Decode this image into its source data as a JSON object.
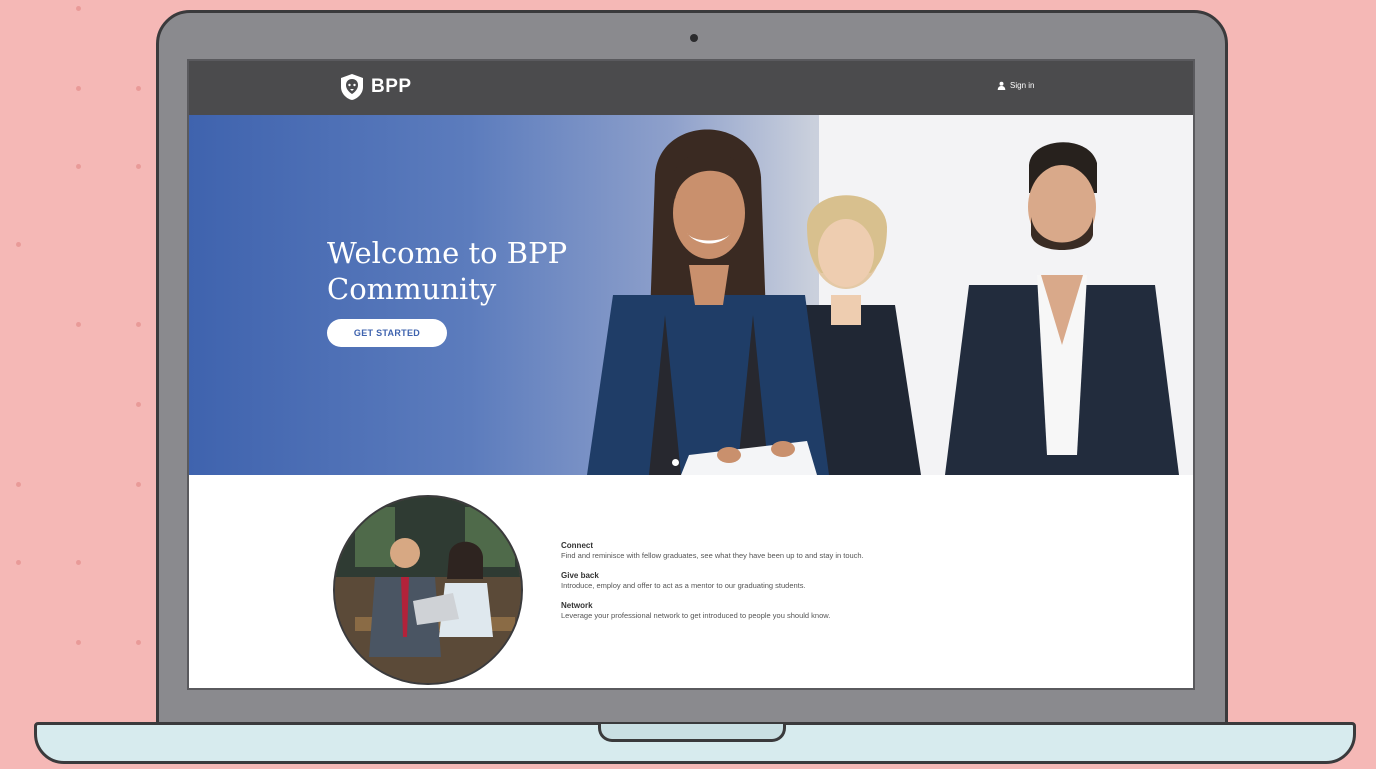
{
  "header": {
    "brand": "BPP",
    "signin_label": "Sign in"
  },
  "hero": {
    "title_line1": "Welcome to BPP",
    "title_line2": "Community",
    "cta_label": "GET STARTED"
  },
  "features": [
    {
      "title": "Connect",
      "text": "Find and reminisce with fellow graduates, see what they have been up to and stay in touch."
    },
    {
      "title": "Give back",
      "text": "Introduce, employ and offer to act as a mentor to our graduating students."
    },
    {
      "title": "Network",
      "text": "Leverage your professional network to get introduced to people you should know."
    }
  ],
  "colors": {
    "background": "#f5b8b6",
    "navbar": "#4b4b4d",
    "hero_blue": "#3f63ae",
    "laptop_base": "#d7ebee"
  },
  "icons": {
    "brand": "lion-shield-icon",
    "signin": "user-icon"
  }
}
